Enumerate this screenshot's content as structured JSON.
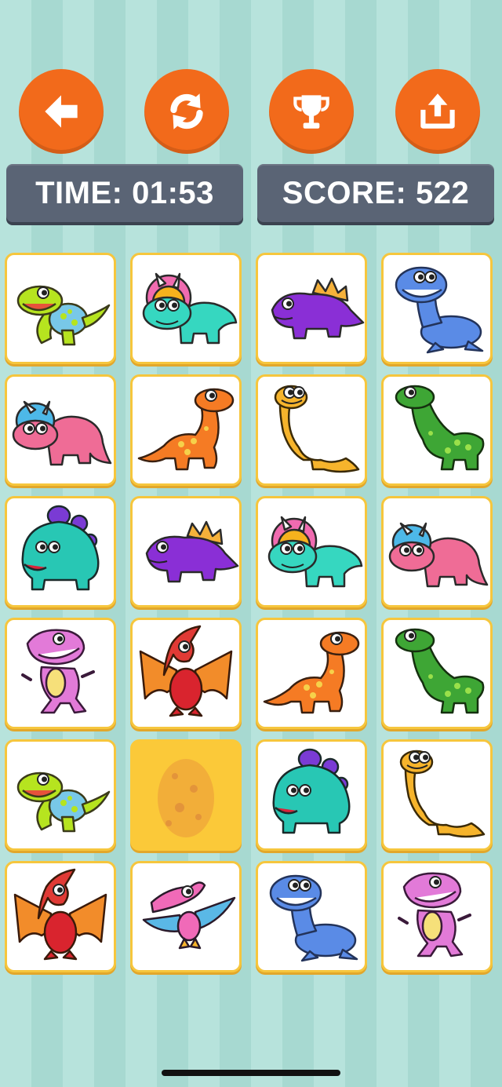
{
  "toolbar": {
    "back_icon": "arrow-left-icon",
    "restart_icon": "refresh-icon",
    "leaderboard_icon": "trophy-icon",
    "share_icon": "share-icon",
    "button_color": "#f26a1b"
  },
  "stats": {
    "time": "TIME: 01:53",
    "score": "SCORE: 522"
  },
  "board": {
    "rows": 6,
    "columns": 4,
    "tiles": [
      "lime-spotted-dino",
      "cyan-triceratops",
      "purple-stegosaurus",
      "blue-plesiosaur",
      "pink-triceratops",
      "orange-brontosaurus",
      "yellow-brontosaurus",
      "green-brontosaurus",
      "teal-stegosaurus",
      "purple-stegosaurus",
      "cyan-triceratops",
      "pink-triceratops",
      "pink-trex",
      "red-pterodactyl",
      "orange-brontosaurus",
      "green-brontosaurus",
      "lime-spotted-dino",
      "hidden-egg",
      "teal-stegosaurus",
      "yellow-brontosaurus",
      "red-pterodactyl",
      "pink-pterodactyl",
      "blue-plesiosaur",
      "pink-trex"
    ]
  }
}
